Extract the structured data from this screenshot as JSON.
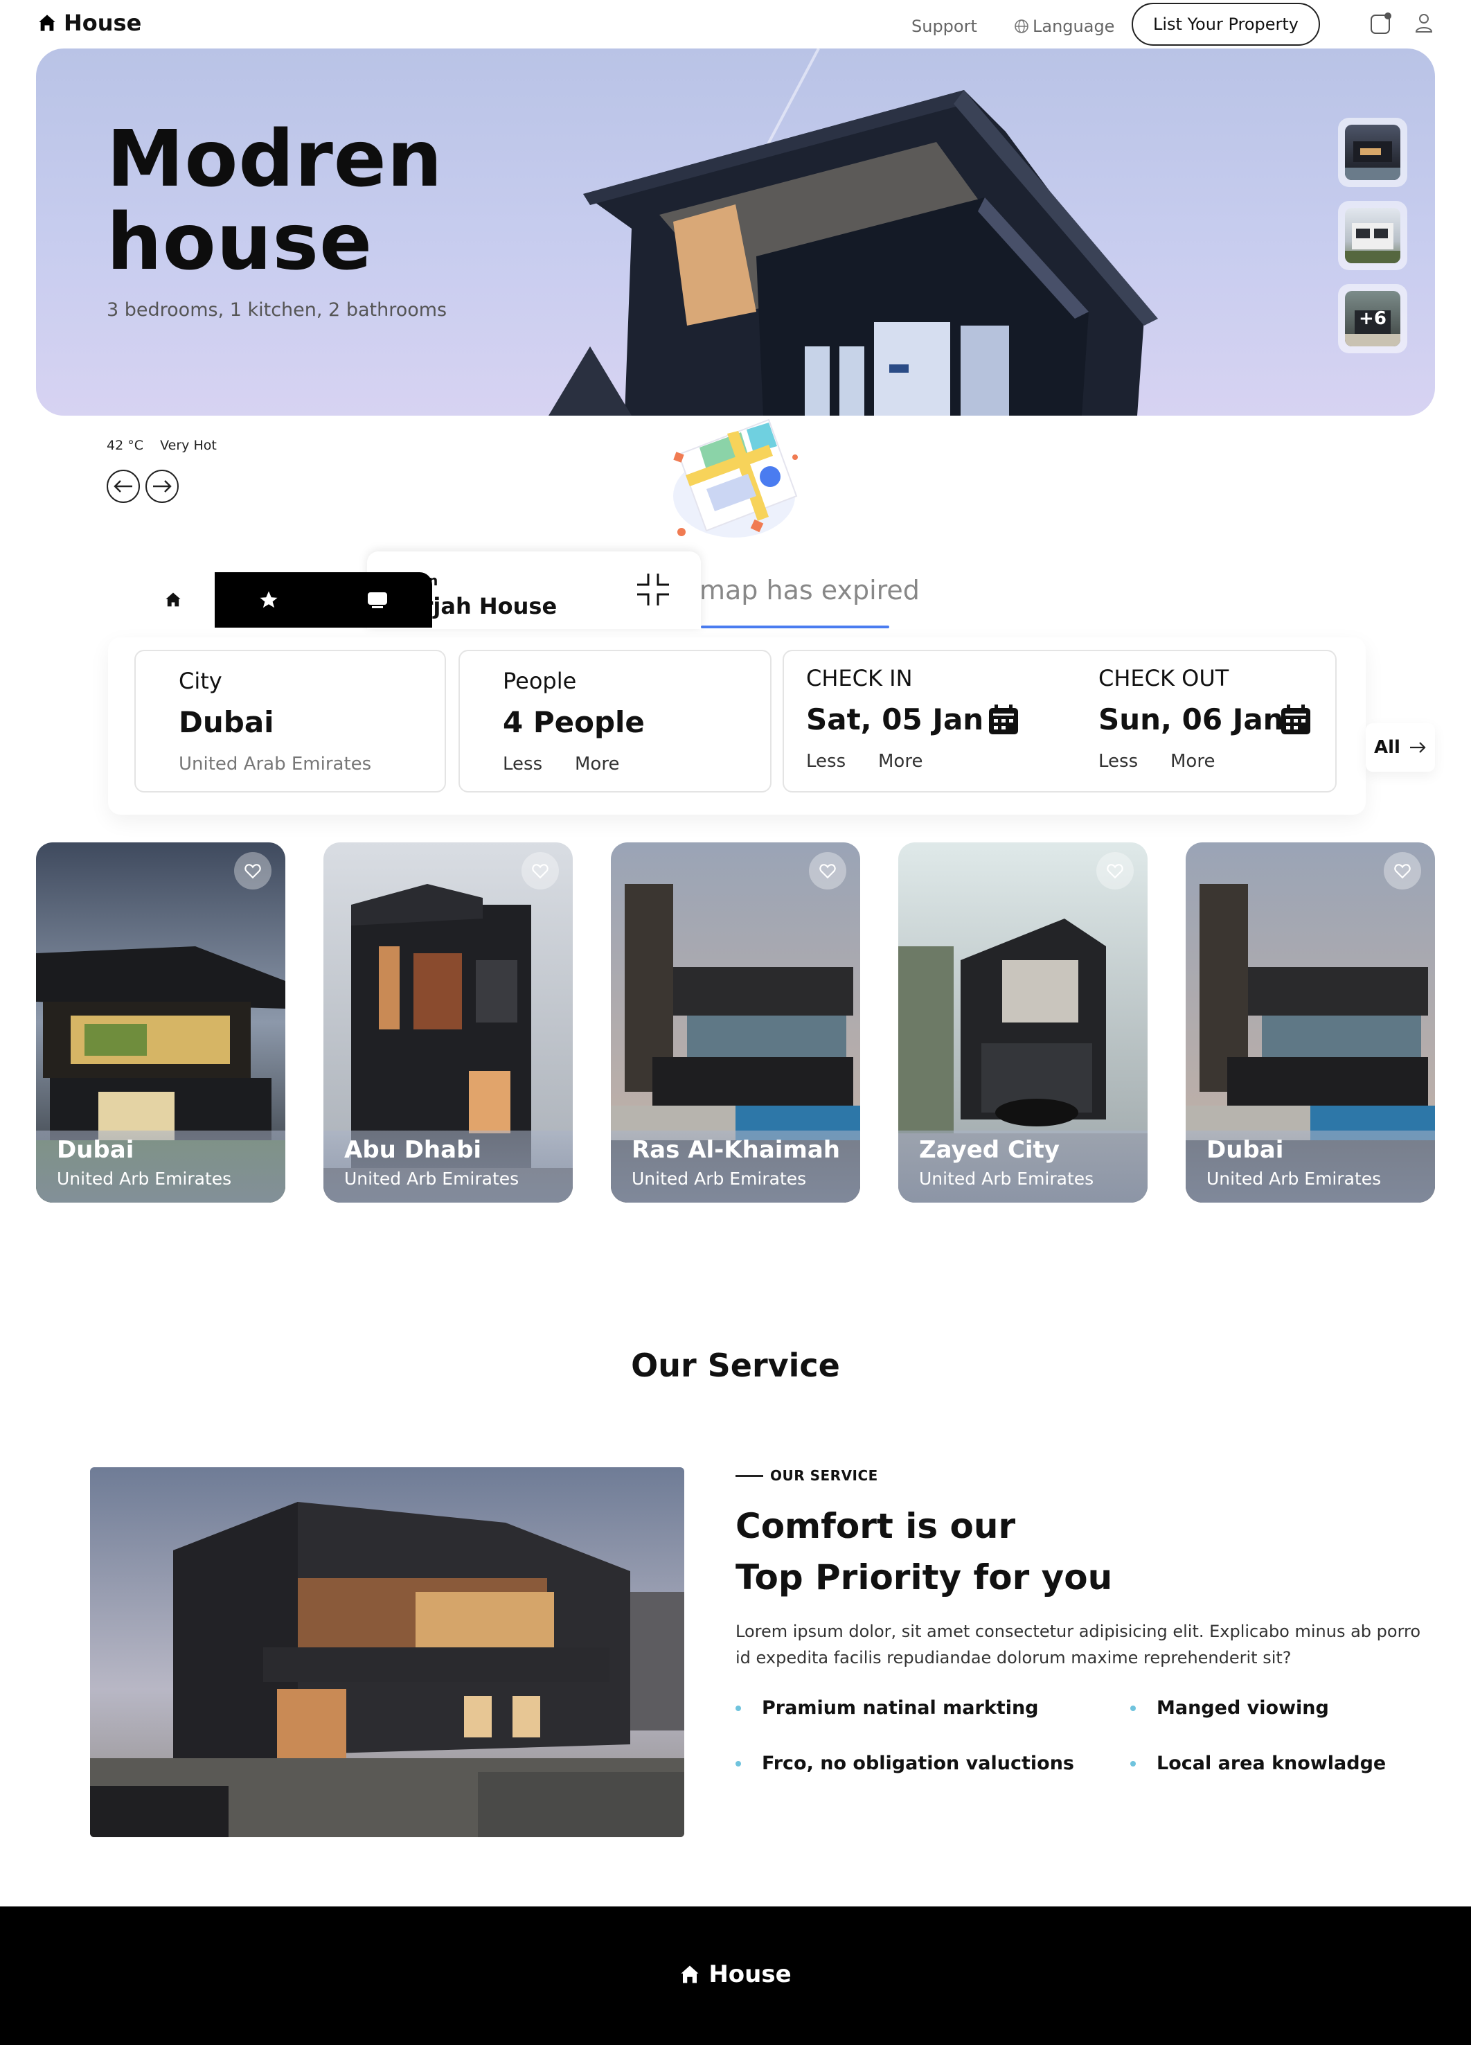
{
  "nav": {
    "logo": "House",
    "support": "Support",
    "language": "Language",
    "list_property": "List Your Property"
  },
  "hero": {
    "title_line1": "Modren",
    "title_line2": "house",
    "subtitle": "3 bedrooms, 1 kitchen, 2 bathrooms",
    "more_photos": "+6"
  },
  "weather": {
    "temp": "42 °C",
    "status": "Very Hot"
  },
  "map": {
    "expired": "map has expired"
  },
  "location": {
    "label": "tion",
    "value": "arjah House"
  },
  "search": {
    "city": {
      "label": "City",
      "value": "Dubai",
      "sub": "United Arab Emirates"
    },
    "people": {
      "label": "People",
      "value": "4 People",
      "less": "Less",
      "more": "More"
    },
    "checkin": {
      "label": "CHECK IN",
      "value": "Sat, 05 Jan",
      "less": "Less",
      "more": "More"
    },
    "checkout": {
      "label": "CHECK OUT",
      "value": "Sun, 06 Jan",
      "less": "Less",
      "more": "More"
    },
    "all": "All"
  },
  "properties": [
    {
      "city": "Dubai",
      "country": "United Arb Emirates"
    },
    {
      "city": "Abu Dhabi",
      "country": "United Arb Emirates"
    },
    {
      "city": "Ras Al-Khaimah",
      "country": "United Arb Emirates"
    },
    {
      "city": "Zayed City",
      "country": "United Arb Emirates"
    },
    {
      "city": "Dubai",
      "country": "United Arb Emirates"
    }
  ],
  "services": {
    "title": "Our Service",
    "eyebrow": "OUR SERVICE",
    "heading_line1": "Comfort is our",
    "heading_line2": "Top Priority for you",
    "text": "Lorem ipsum dolor, sit amet consectetur adipisicing elit. Explicabo minus ab porro id expedita facilis repudiandae dolorum maxime reprehenderit sit?",
    "bullets": [
      "Pramium natinal markting",
      "Manged viowing",
      "Frco, no obligation valuctions",
      "Local area knowladge"
    ]
  },
  "footer": {
    "logo": "House"
  },
  "colors": {
    "accent": "#6fc3dd",
    "map_blue": "#4a7cf0",
    "dark": "#000000"
  },
  "icons": [
    "home-icon",
    "globe-icon",
    "bag-icon",
    "user-icon",
    "arrow-left-icon",
    "arrow-right-icon",
    "star-icon",
    "chat-icon",
    "collapse-icon",
    "calendar-icon",
    "heart-icon",
    "map-icon"
  ]
}
